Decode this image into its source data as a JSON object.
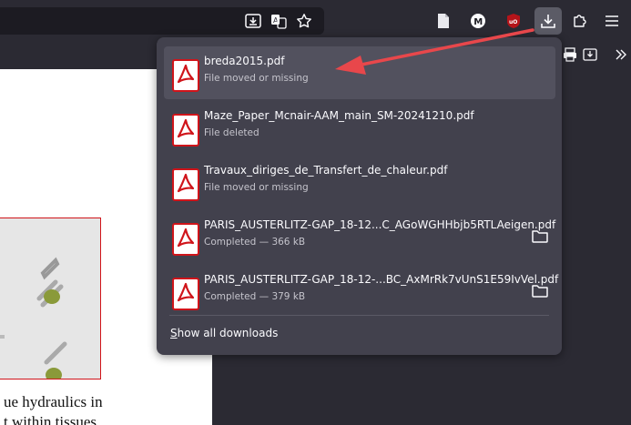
{
  "downloads": {
    "items": [
      {
        "filename": "breda2015.pdf",
        "status": "File moved or missing",
        "show_folder": false
      },
      {
        "filename": "Maze_Paper_Mcnair-AAM_main_SM-20241210.pdf",
        "status": "File deleted",
        "show_folder": false
      },
      {
        "filename": "Travaux_diriges_de_Transfert_de_chaleur.pdf",
        "status": "File moved or missing",
        "show_folder": false
      },
      {
        "filename": "PARIS_AUSTERLITZ-GAP_18-12...C_AGoWGHHbjb5RTLAeigen.pdf",
        "status": "Completed — 366 kB",
        "show_folder": true
      },
      {
        "filename": "PARIS_AUSTERLITZ-GAP_18-12-...BC_AxMrRk7vUnS1E59IvVel.pdf",
        "status": "Completed — 379 kB",
        "show_folder": true
      }
    ],
    "show_all_first": "S",
    "show_all_rest": "how all downloads"
  },
  "page": {
    "text_line1": "ue hydraulics in",
    "text_line2": "t within tissues"
  },
  "colors": {
    "panel_bg": "#42414d",
    "pdf_red": "#d0141a",
    "annotation_arrow": "#e8474b"
  }
}
